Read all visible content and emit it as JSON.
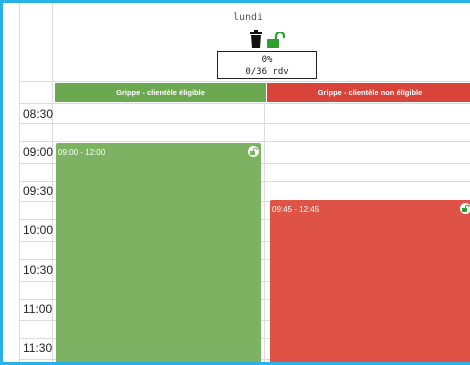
{
  "day": {
    "name": "lundi"
  },
  "stats": {
    "percent": "0%",
    "appointments": "0/36 rdv"
  },
  "columns": [
    {
      "label": "Grippe - clientèle éligible",
      "color": "#6ba84f"
    },
    {
      "label": "Grippe - clientèle non éligible",
      "color": "#d8433a"
    }
  ],
  "times": [
    "08:30",
    "09:00",
    "09:30",
    "10:00",
    "10:30",
    "11:00",
    "11:30"
  ],
  "events": [
    {
      "time": "09:00 - 12:00",
      "color": "#7cb261"
    },
    {
      "time": "09:45 - 12:45",
      "color": "#de5346"
    }
  ],
  "icons": {
    "trash": "trash-icon",
    "lock": "unlocked-padlock-icon"
  }
}
